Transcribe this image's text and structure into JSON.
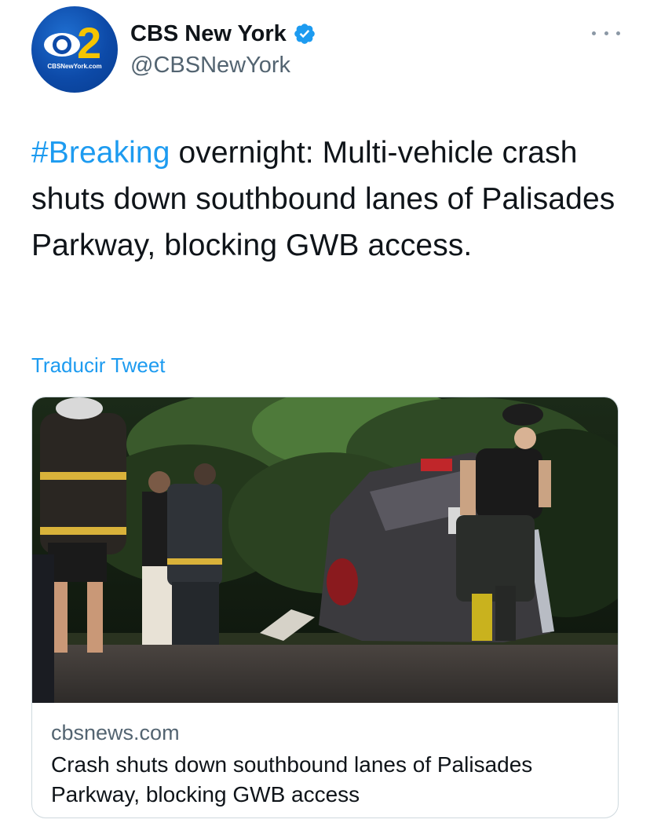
{
  "author": {
    "display_name": "CBS New York",
    "handle": "@CBSNewYork",
    "verified_icon": "verified-badge-icon",
    "avatar": {
      "logo_text": "2",
      "site_text": "CBSNewYork.com"
    }
  },
  "more_icon": "more-options-icon",
  "tweet": {
    "hashtag": "#Breaking",
    "text": " overnight: Multi-vehicle crash shuts down southbound lanes of Palisades Parkway, blocking GWB access."
  },
  "translate_label": "Traducir Tweet",
  "card": {
    "domain": "cbsnews.com",
    "title": "Crash shuts down southbound lanes of Palisades Parkway, blocking GWB access",
    "image_alt_icon": "crash-scene-photo"
  },
  "colors": {
    "link": "#1d9bf0",
    "text": "#0f1419",
    "muted": "#536471",
    "border": "#cfd9de",
    "avatar_blue": "#0d4aa8",
    "avatar_yellow": "#f5c400"
  }
}
